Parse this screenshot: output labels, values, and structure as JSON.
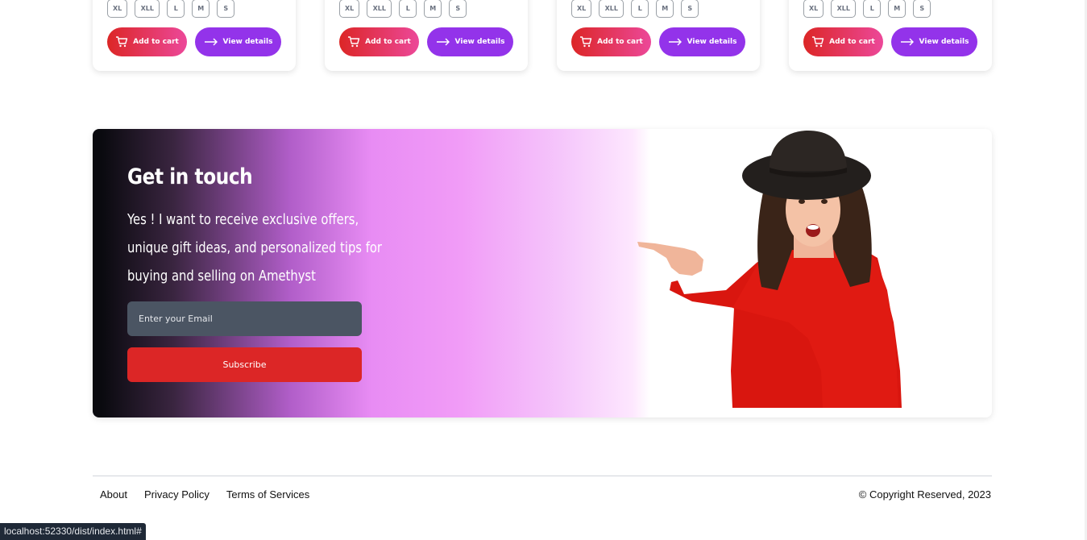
{
  "products": [
    {
      "sizes": [
        "XL",
        "XLL",
        "L",
        "M",
        "S"
      ],
      "add_to_cart": "Add to cart",
      "view_details": "View details"
    },
    {
      "sizes": [
        "XL",
        "XLL",
        "L",
        "M",
        "S"
      ],
      "add_to_cart": "Add to cart",
      "view_details": "View details"
    },
    {
      "sizes": [
        "XL",
        "XLL",
        "L",
        "M",
        "S"
      ],
      "add_to_cart": "Add to cart",
      "view_details": "View details"
    },
    {
      "sizes": [
        "XL",
        "XLL",
        "L",
        "M",
        "S"
      ],
      "add_to_cart": "Add to cart",
      "view_details": "View details"
    }
  ],
  "newsletter": {
    "title": "Get in touch",
    "lead": "Yes ! I want to receive exclusive offers, unique gift ideas, and personalized tips for buying and selling on Amethyst",
    "email_placeholder": "Enter your Email",
    "subscribe_label": "Subscribe"
  },
  "footer": {
    "links": [
      "About",
      "Privacy Policy",
      "Terms of Services"
    ],
    "copyright": "© Copyright Reserved, 2023"
  },
  "status_bar": {
    "url": "localhost:52330/dist/index.html#"
  },
  "colors": {
    "add_to_cart_gradient": [
      "#dc2626",
      "#ec4899"
    ],
    "view_details": "#9333ea",
    "subscribe": "#dc2626",
    "email_field": "#4b5563"
  },
  "icons": {
    "add_to_cart": "cart-icon",
    "view_details": "arrow-right-icon"
  }
}
